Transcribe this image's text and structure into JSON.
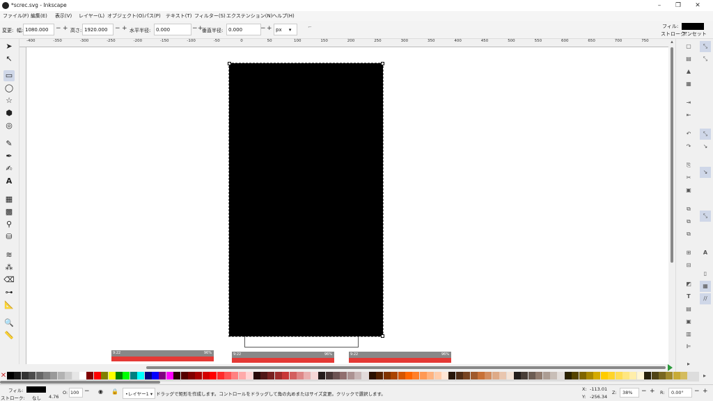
{
  "window": {
    "title": "*screc.svg - Inkscape",
    "minimize": "–",
    "maximize": "❐",
    "close": "✕"
  },
  "menu": [
    "ファイル(F)",
    "編集(E)",
    "表示(V)",
    "レイヤー(L)",
    "オブジェクト(O)",
    "パス(P)",
    "テキスト(T)",
    "フィルター(S)",
    "エクステンション(N)",
    "ヘルプ(H)"
  ],
  "controls": {
    "change_label": "変更:",
    "width_label": "幅:",
    "width_value": "1080.000",
    "height_label": "高さ:",
    "height_value": "1920.000",
    "rx_label": "水平半径:",
    "rx_value": "0.000",
    "ry_label": "垂直半径:",
    "ry_value": "0.000",
    "unit": "px",
    "minus": "−",
    "plus": "+",
    "fill_label": "フィル:",
    "stroke_label": "ストローク:",
    "stroke_value": "アンセット",
    "fill_color": "#000000"
  },
  "ruler": [
    "-400",
    "-350",
    "-300",
    "-250",
    "-200",
    "-150",
    "-100",
    "-50",
    "0",
    "50",
    "100",
    "150",
    "200",
    "250",
    "300",
    "350",
    "400",
    "450",
    "500",
    "550",
    "600",
    "650",
    "700",
    "750"
  ],
  "thumbnails": [
    {
      "time": "9:22",
      "battery": "96%"
    },
    {
      "time": "9:22",
      "battery": "96%"
    },
    {
      "time": "9:22",
      "battery": "96%"
    }
  ],
  "palette": [
    "#000000",
    "#1a1a1a",
    "#333333",
    "#4d4d4d",
    "#666666",
    "#808080",
    "#999999",
    "#b3b3b3",
    "#cccccc",
    "#e6e6e6",
    "#ffffff",
    "#800000",
    "#ff0000",
    "#808000",
    "#ffff00",
    "#008000",
    "#00ff00",
    "#008080",
    "#00ffff",
    "#000080",
    "#0000ff",
    "#800080",
    "#ff00ff",
    "#2b0000",
    "#550000",
    "#800000",
    "#aa0000",
    "#d40000",
    "#ff0000",
    "#ff2a2a",
    "#ff5555",
    "#ff8080",
    "#ffaaaa",
    "#ffd5d5",
    "#280b0b",
    "#501616",
    "#782121",
    "#a02c2c",
    "#c83737",
    "#d35f5f",
    "#de8787",
    "#e9afaf",
    "#f4d7d7",
    "#241c1c",
    "#483737",
    "#6c5353",
    "#916f6f",
    "#ac9393",
    "#c8b7b7",
    "#e3dbdb",
    "#2b1100",
    "#552200",
    "#803300",
    "#aa4400",
    "#d45500",
    "#ff6600",
    "#ff7f2a",
    "#ff9955",
    "#ffb380",
    "#ffccaa",
    "#ffe6d5",
    "#28170b",
    "#502d16",
    "#784421",
    "#a05a2c",
    "#c87137",
    "#d38d5f",
    "#deaa87",
    "#e9c6af",
    "#f4e3d7",
    "#241f1c",
    "#483e37",
    "#6c5d53",
    "#917c6f",
    "#ac9d93",
    "#c8beb7",
    "#e3dedb",
    "#2b2200",
    "#554400",
    "#806600",
    "#aa8800",
    "#d4aa00",
    "#ffcc00",
    "#ffd42a",
    "#ffdd55",
    "#ffe680",
    "#ffeeaa",
    "#fff6d5",
    "#28220b",
    "#504416",
    "#786721",
    "#a0892c",
    "#c8ab37",
    "#d4bc5f"
  ],
  "status": {
    "fill_label": "フィル:",
    "stroke_label": "ストローク:",
    "stroke_none": "なし",
    "stroke_width": "4.76",
    "opacity_label": "O:",
    "opacity_value": "100",
    "layer": "•レイヤー1",
    "message": "ドラッグで矩形を作成します。コントロールをドラッグして角の丸めまたはサイズ変更。クリックで選択します。",
    "x_label": "X:",
    "x_value": "-113.01",
    "y_label": "Y:",
    "y_value": "-256.34",
    "z_label": "Z:",
    "zoom": "38%",
    "r_label": "R:",
    "rotation": "0.00°"
  }
}
